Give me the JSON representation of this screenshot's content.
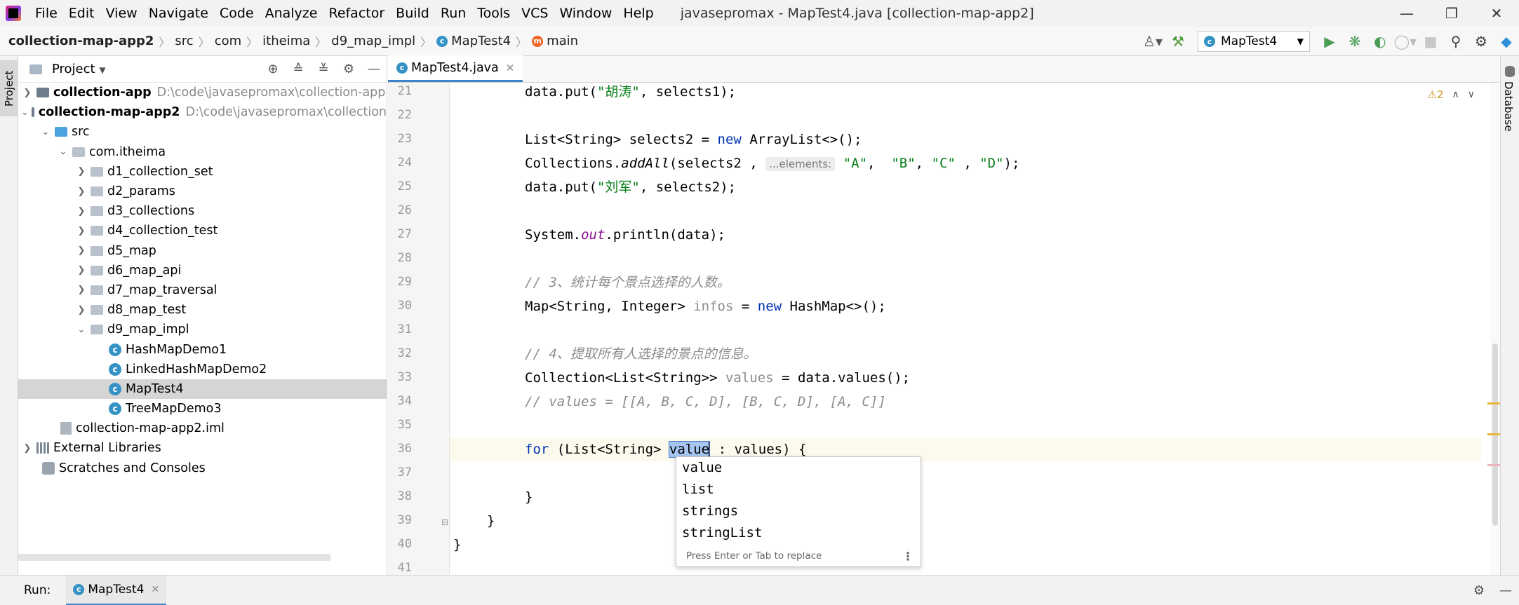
{
  "titlebar": {
    "menu": [
      "File",
      "Edit",
      "View",
      "Navigate",
      "Code",
      "Analyze",
      "Refactor",
      "Build",
      "Run",
      "Tools",
      "VCS",
      "Window",
      "Help"
    ],
    "window_title": "javasepromax - MapTest4.java [collection-map-app2]"
  },
  "navbar": {
    "crumbs": [
      "collection-map-app2",
      "src",
      "com",
      "itheima",
      "d9_map_impl",
      "MapTest4",
      "main"
    ],
    "run_config": "MapTest4"
  },
  "left_stripe": {
    "tab": "Project"
  },
  "project": {
    "title": "Project",
    "tree": [
      {
        "label": "collection-app",
        "path": "D:\\code\\javasepromax\\collection-app"
      },
      {
        "label": "collection-map-app2",
        "path": "D:\\code\\javasepromax\\collection"
      },
      {
        "label": "src"
      },
      {
        "label": "com.itheima"
      },
      {
        "label": "d1_collection_set"
      },
      {
        "label": "d2_params"
      },
      {
        "label": "d3_collections"
      },
      {
        "label": "d4_collection_test"
      },
      {
        "label": "d5_map"
      },
      {
        "label": "d6_map_api"
      },
      {
        "label": "d7_map_traversal"
      },
      {
        "label": "d8_map_test"
      },
      {
        "label": "d9_map_impl"
      },
      {
        "label": "HashMapDemo1"
      },
      {
        "label": "LinkedHashMapDemo2"
      },
      {
        "label": "MapTest4"
      },
      {
        "label": "TreeMapDemo3"
      },
      {
        "label": "collection-map-app2.iml"
      },
      {
        "label": "External Libraries"
      },
      {
        "label": "Scratches and Consoles"
      }
    ]
  },
  "editor": {
    "tab": "MapTest4.java",
    "line_numbers": [
      "21",
      "22",
      "23",
      "24",
      "25",
      "26",
      "27",
      "28",
      "29",
      "30",
      "31",
      "32",
      "33",
      "34",
      "35",
      "36",
      "37",
      "38",
      "39",
      "40",
      "41"
    ],
    "inspection_count": "2",
    "code": {
      "l21_a": "data.put(",
      "l21_str": "\"胡涛\"",
      "l21_b": ", selects1);",
      "l23_a": "List<String> selects2 = ",
      "l23_kw": "new",
      "l23_b": " ArrayList<>();",
      "l24_a": "Collections.",
      "l24_m": "addAll",
      "l24_b": "(selects2 , ",
      "l24_hint": "...elements:",
      "l24_s1": "\"A\"",
      "l24_c1": ",  ",
      "l24_s2": "\"B\"",
      "l24_c2": ", ",
      "l24_s3": "\"C\"",
      "l24_c3": " , ",
      "l24_s4": "\"D\"",
      "l24_end": ");",
      "l25_a": "data.put(",
      "l25_str": "\"刘军\"",
      "l25_b": ", selects2);",
      "l27_a": "System.",
      "l27_fld": "out",
      "l27_b": ".println(data);",
      "l29_cmt": "// 3、统计每个景点选择的人数。",
      "l30_a": "Map<String, Integer> ",
      "l30_var": "infos",
      "l30_b": " = ",
      "l30_kw": "new",
      "l30_c": " HashMap<>();",
      "l32_cmt": "// 4、提取所有人选择的景点的信息。",
      "l33_a": "Collection<List<String>> ",
      "l33_var": "values",
      "l33_b": " = data.values();",
      "l34_cmt": "// values = [[A, B, C, D], [B, C, D], [A, C]]",
      "l36_kw": "for",
      "l36_a": " (List<String> ",
      "l36_sel": "value",
      "l36_b": " : values) {",
      "l38": "}",
      "l39": "}",
      "l40": "}"
    }
  },
  "completion": {
    "items": [
      "value",
      "list",
      "strings",
      "stringList"
    ],
    "footer": "Press Enter or Tab to replace"
  },
  "right_stripe": {
    "tab": "Database"
  },
  "runbar": {
    "label": "Run:",
    "tab": "MapTest4"
  }
}
